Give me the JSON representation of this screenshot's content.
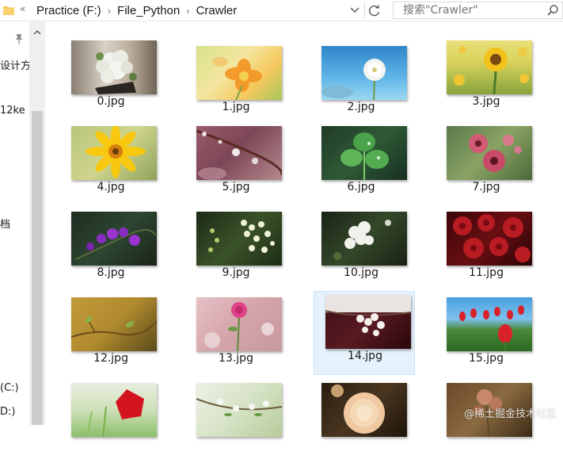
{
  "address": {
    "overflow_chevron": "«",
    "crumbs": [
      "Practice (F:)",
      "File_Python",
      "Crawler"
    ],
    "separator": "›"
  },
  "search": {
    "placeholder": "搜索\"Crawler\""
  },
  "nav": {
    "items": [
      "设计方",
      "12ke",
      "档",
      "(C:)",
      "D:)"
    ]
  },
  "files": [
    {
      "name": "0.jpg",
      "icon": "white-roses-image"
    },
    {
      "name": "1.jpg",
      "icon": "orange-flower-image"
    },
    {
      "name": "2.jpg",
      "icon": "white-dandelion-image"
    },
    {
      "name": "3.jpg",
      "icon": "sunflower-image"
    },
    {
      "name": "4.jpg",
      "icon": "yellow-gerbera-image"
    },
    {
      "name": "5.jpg",
      "icon": "water-droplets-image"
    },
    {
      "name": "6.jpg",
      "icon": "green-leaf-image"
    },
    {
      "name": "7.jpg",
      "icon": "pink-flowers-image"
    },
    {
      "name": "8.jpg",
      "icon": "purple-orchid-image"
    },
    {
      "name": "9.jpg",
      "icon": "white-blossoms-image"
    },
    {
      "name": "10.jpg",
      "icon": "white-geranium-image"
    },
    {
      "name": "11.jpg",
      "icon": "red-roses-image"
    },
    {
      "name": "12.jpg",
      "icon": "spring-twig-image"
    },
    {
      "name": "13.jpg",
      "icon": "pink-rose-image"
    },
    {
      "name": "14.jpg",
      "icon": "white-cherry-blossom-image",
      "selected": true
    },
    {
      "name": "15.jpg",
      "icon": "red-tulips-image"
    },
    {
      "name": "",
      "icon": "red-poppy-image"
    },
    {
      "name": "",
      "icon": "blossom-branch-image"
    },
    {
      "name": "",
      "icon": "peach-camellia-image"
    },
    {
      "name": "",
      "icon": "dried-flower-image"
    }
  ],
  "watermark": "@稀土掘金技术社区",
  "colors": {
    "selection_bg": "#e5f1fb",
    "selection_border": "#cce4f7",
    "folder": "#f5c242"
  }
}
